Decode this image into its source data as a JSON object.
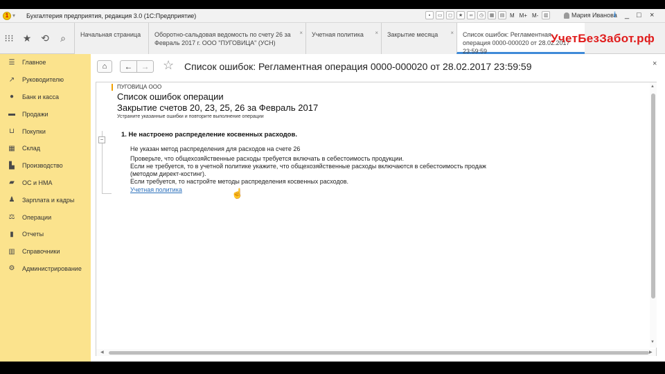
{
  "window": {
    "title": "Бухгалтерия предприятия, редакция 3.0  (1С:Предприятие)",
    "toolbar_m": [
      "M",
      "M+",
      "M-"
    ],
    "user_name": "Мария Иванова",
    "controls": [
      "i",
      "_",
      "□",
      "×"
    ]
  },
  "tabs": [
    {
      "label": "Начальная страница"
    },
    {
      "label": "Оборотно-сальдовая ведомость по счету 26 за Февраль 2017 г. ООО \"ПУГОВИЦА\" (УСН)"
    },
    {
      "label": "Учетная политика"
    },
    {
      "label": "Закрытие месяца"
    },
    {
      "label": "Список ошибок: Регламентная операция 0000-000020 от 28.02.2017 23:59:59"
    }
  ],
  "watermark": "УчетБезЗабот.рф",
  "sidebar": {
    "items": [
      {
        "label": "Главное",
        "icon": "menu-icon"
      },
      {
        "label": "Руководителю",
        "icon": "trend-icon"
      },
      {
        "label": "Банк и касса",
        "icon": "coin-icon"
      },
      {
        "label": "Продажи",
        "icon": "cart-icon"
      },
      {
        "label": "Покупки",
        "icon": "basket-icon"
      },
      {
        "label": "Склад",
        "icon": "warehouse-icon"
      },
      {
        "label": "Производство",
        "icon": "factory-icon"
      },
      {
        "label": "ОС и НМА",
        "icon": "truck-icon"
      },
      {
        "label": "Зарплата и кадры",
        "icon": "person-icon"
      },
      {
        "label": "Операции",
        "icon": "operations-icon"
      },
      {
        "label": "Отчеты",
        "icon": "report-icon"
      },
      {
        "label": "Справочники",
        "icon": "books-icon"
      },
      {
        "label": "Администрирование",
        "icon": "gear-icon"
      }
    ]
  },
  "page": {
    "title": "Список ошибок: Регламентная операция 0000-000020 от 28.02.2017 23:59:59"
  },
  "report": {
    "org": "ПУГОВИЦА ООО",
    "heading1": "Список ошибок операции",
    "heading2": "Закрытие счетов 20, 23, 25, 26 за Февраль 2017",
    "note": "Устраните указанные ошибки и повторите выполнение операции",
    "error_title": "1. Не настроено распределение косвенных расходов.",
    "lines": [
      "Не указан метод распределения для расходов на счете 26",
      "Проверьте, что общехозяйственные расходы требуется включать в себестоимость продукции.",
      "Если не требуется, то в учетной политике укажите, что общехозяйственные расходы включаются в себестоимость продаж",
      "(методом директ-костинг).",
      "Если требуется, то настройте методы распределения косвенных расходов."
    ],
    "link": "Учетная политика"
  }
}
